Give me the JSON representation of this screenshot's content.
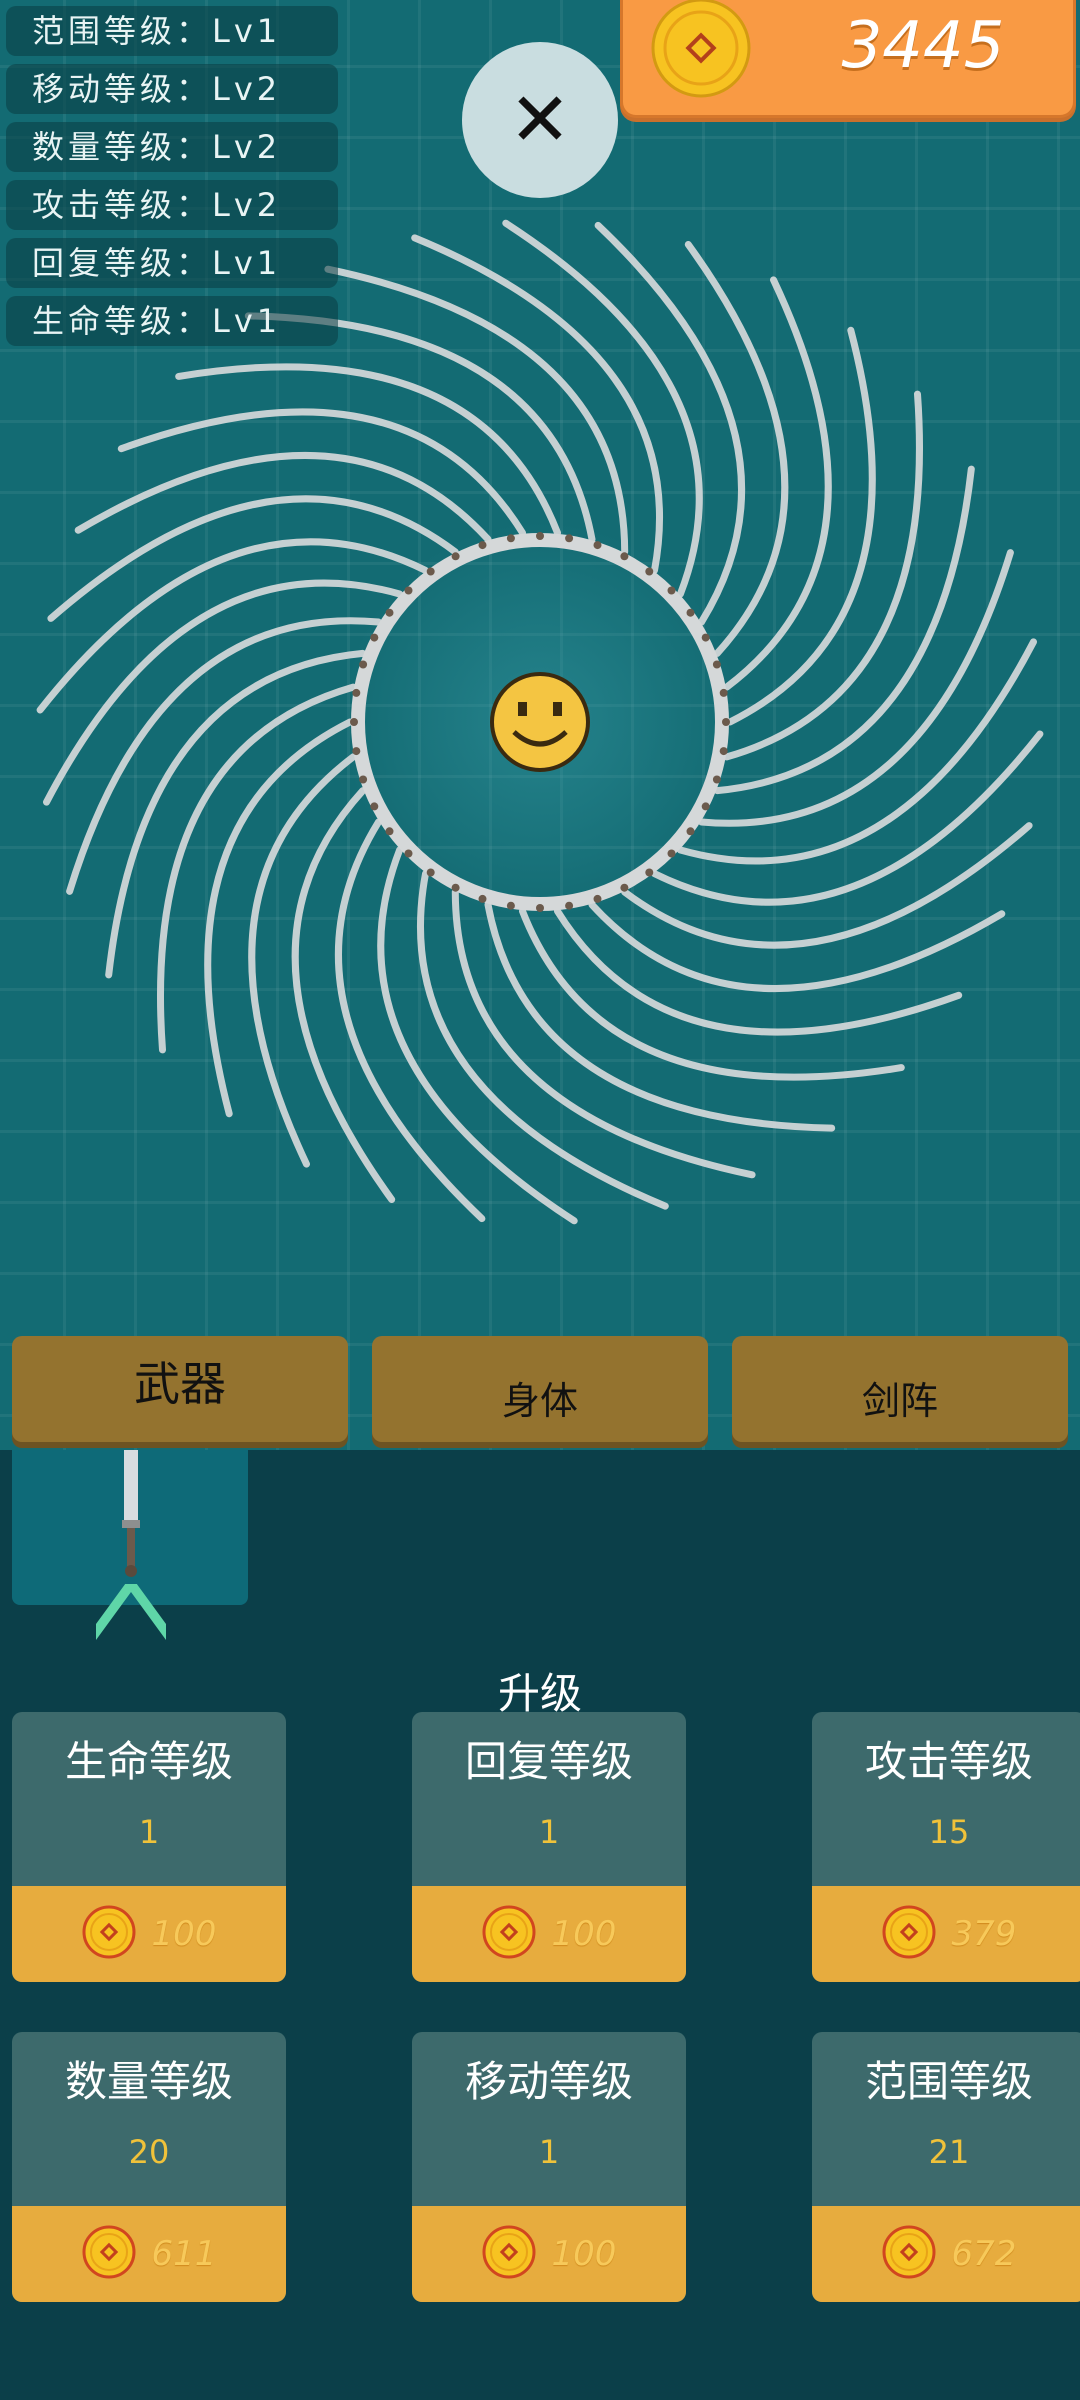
{
  "stats": [
    {
      "label": "范围等级：Lv1"
    },
    {
      "label": "移动等级：Lv2"
    },
    {
      "label": "数量等级：Lv2"
    },
    {
      "label": "攻击等级：Lv2"
    },
    {
      "label": "回复等级：Lv1"
    },
    {
      "label": "生命等级：Lv1"
    }
  ],
  "close_label": "✕",
  "coins": "3445",
  "tabs": [
    "武器",
    "身体",
    "剑阵"
  ],
  "active_tab": "武器",
  "upgrade_title": "升级",
  "upgrades": [
    {
      "name": "生命等级",
      "level": "1",
      "price": "100"
    },
    {
      "name": "回复等级",
      "level": "1",
      "price": "100"
    },
    {
      "name": "攻击等级",
      "level": "15",
      "price": "379"
    },
    {
      "name": "数量等级",
      "level": "20",
      "price": "611"
    },
    {
      "name": "移动等级",
      "level": "1",
      "price": "100"
    },
    {
      "name": "范围等级",
      "level": "21",
      "price": "672"
    }
  ],
  "colors": {
    "arena": "#136b73",
    "panel_bottom": "#0b3f49",
    "coin_panel": "#f99a44",
    "tab": "#94732f",
    "card": "#3d6a6c",
    "price_bar": "#e7ac3e",
    "level_text": "#f0c23a",
    "arrow": "#5fd6a8"
  },
  "icons": {
    "coin": "gold-coin-icon",
    "player": "smiley-face-icon",
    "close": "close-icon",
    "weapon": "sword-icon",
    "arrow": "chevron-up-icon"
  }
}
